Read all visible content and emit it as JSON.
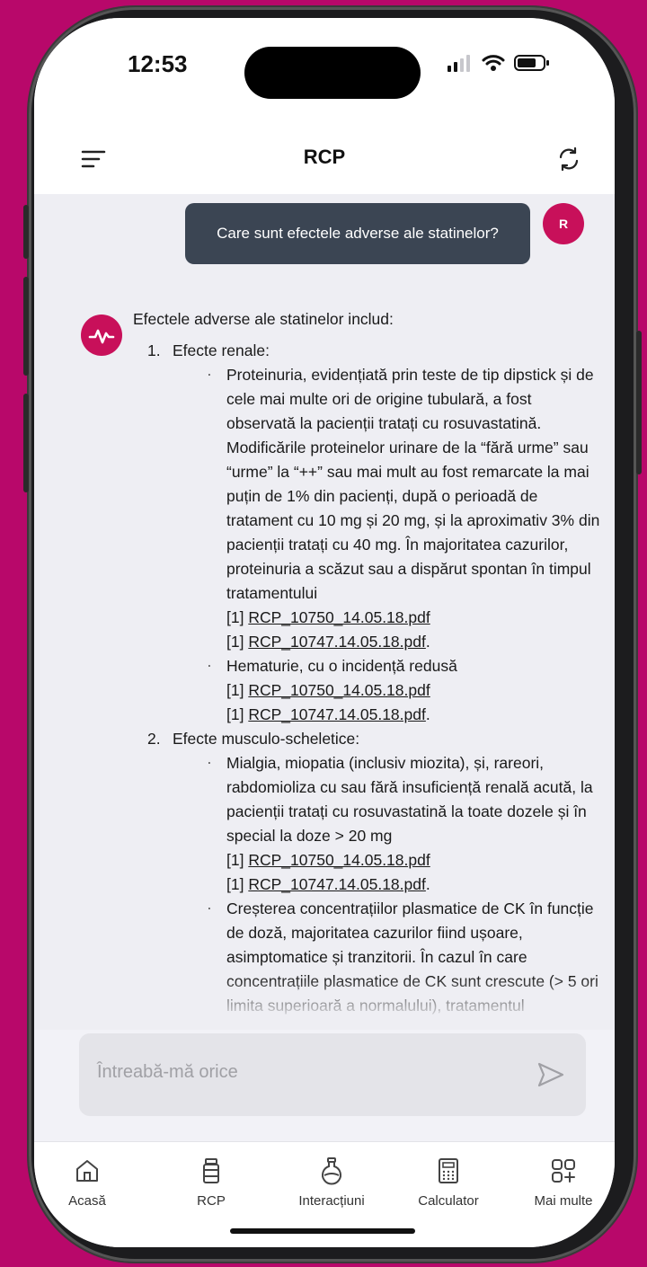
{
  "status": {
    "time": "12:53"
  },
  "header": {
    "title": "RCP"
  },
  "chat": {
    "user_message": "Care sunt efectele adverse ale statinelor?",
    "user_initial": "R",
    "answer": {
      "intro": "Efectele adverse ale statinelor includ:",
      "sections": [
        {
          "number": "1.",
          "title": "Efecte renale:",
          "items": [
            {
              "text": "Proteinuria, evidențiată prin teste de tip dipstick și de cele mai multe ori de origine tubulară, a fost observată la pacienții tratați cu rosuvastatină. Modificările proteinelor urinare de la “fără urme” sau “urme” la “++” sau mai mult au fost remarcate la mai puțin de 1% din pacienți, după o perioadă de tratament cu 10 mg și 20 mg, și la aproximativ 3% din pacienții tratați cu 40 mg. În majoritatea cazurilor, proteinuria a scăzut sau a dispărut spontan în timpul tratamentului",
              "refs": [
                {
                  "prefix": "[1] ",
                  "link": "RCP_10750_14.05.18.pdf",
                  "suffix": ""
                },
                {
                  "prefix": "[1] ",
                  "link": "RCP_10747.14.05.18.pdf",
                  "suffix": "."
                }
              ]
            },
            {
              "text": "Hematurie, cu o incidență redusă",
              "refs": [
                {
                  "prefix": "[1] ",
                  "link": "RCP_10750_14.05.18.pdf",
                  "suffix": ""
                },
                {
                  "prefix": "[1] ",
                  "link": "RCP_10747.14.05.18.pdf",
                  "suffix": "."
                }
              ]
            }
          ]
        },
        {
          "number": "2.",
          "title": "Efecte musculo-scheletice:",
          "items": [
            {
              "text": "Mialgia, miopatia (inclusiv miozita), și, rareori, rabdomioliza cu sau fără insuficiență renală acută, la pacienții tratați cu rosuvastatină la toate dozele și în special la doze > 20 mg",
              "refs": [
                {
                  "prefix": "[1] ",
                  "link": "RCP_10750_14.05.18.pdf",
                  "suffix": ""
                },
                {
                  "prefix": "[1] ",
                  "link": "RCP_10747.14.05.18.pdf",
                  "suffix": "."
                }
              ]
            },
            {
              "text": "Creșterea concentrațiilor plasmatice de CK în funcție de doză, majoritatea cazurilor fiind ușoare, asimptomatice și tranzitorii. În cazul în care concentrațiile plasmatice de CK sunt crescute (> 5 ori limita superioară a normalului), tratamentul",
              "refs": []
            }
          ]
        }
      ]
    }
  },
  "composer": {
    "placeholder": "Întreabă-mă orice"
  },
  "tabs": [
    {
      "label": "Acasă",
      "icon": "home-icon"
    },
    {
      "label": "RCP",
      "icon": "medicine-bottle-icon"
    },
    {
      "label": "Interacțiuni",
      "icon": "flask-icon"
    },
    {
      "label": "Calculator",
      "icon": "calculator-icon"
    },
    {
      "label": "Mai multe",
      "icon": "grid-plus-icon"
    }
  ],
  "colors": {
    "accent": "#c8105a",
    "user_bubble": "#3b4553",
    "background": "#b8086a"
  }
}
